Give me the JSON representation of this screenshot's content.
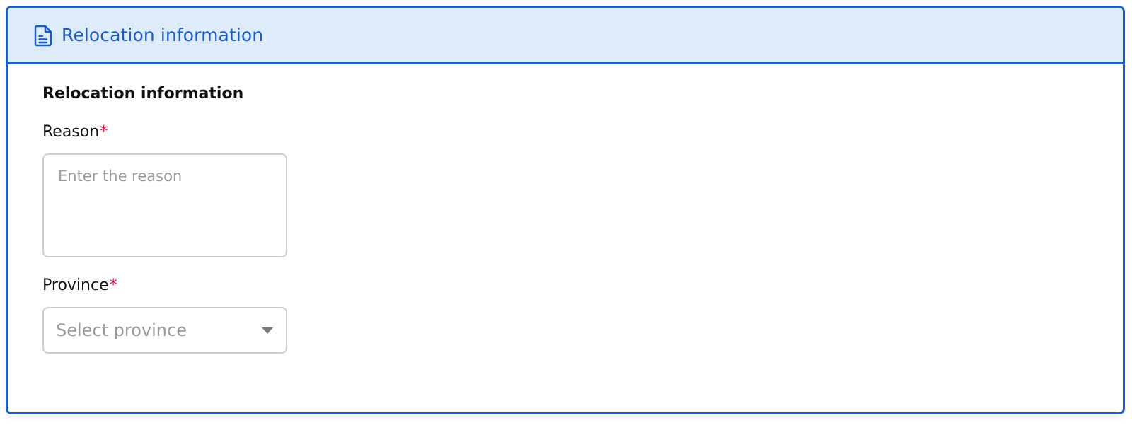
{
  "panel": {
    "header_title": "Relocation information",
    "header_icon": "document-icon",
    "accent_color": "#1f5fbf",
    "header_background": "#deebf8"
  },
  "form": {
    "section_title": "Relocation information",
    "reason": {
      "label": "Reason",
      "required_marker": "*",
      "placeholder": "Enter the reason",
      "value": ""
    },
    "province": {
      "label": "Province",
      "required_marker": "*",
      "placeholder": "Select province",
      "dropdown_icon": "caret-down-icon"
    }
  }
}
